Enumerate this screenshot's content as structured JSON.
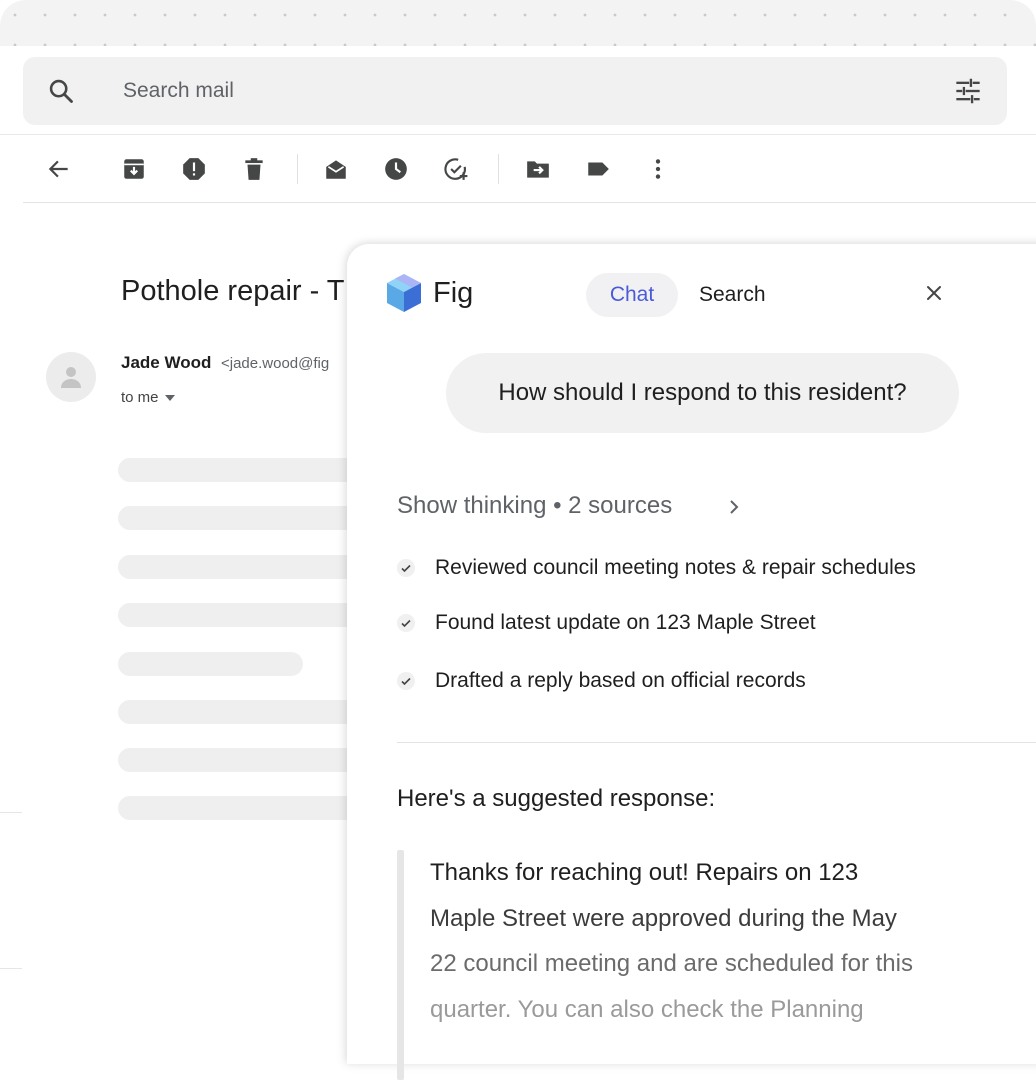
{
  "search": {
    "placeholder": "Search mail"
  },
  "toolbar": {
    "buttons": [
      "back-icon",
      "archive-icon",
      "report-spam-icon",
      "delete-icon",
      "mark-unread-icon",
      "snooze-icon",
      "add-to-tasks-icon",
      "move-to-icon",
      "label-icon",
      "more-vert-icon"
    ]
  },
  "email": {
    "subject": "Pothole repair - T",
    "sender_name": "Jade Wood",
    "sender_email": "<jade.wood@fig",
    "recipient": "to me"
  },
  "fig": {
    "app_name": "Fig",
    "tabs": {
      "chat": "Chat",
      "search": "Search"
    },
    "active_tab": "Chat",
    "user_message": "How should I respond to this resident?",
    "show_thinking": "Show thinking • 2 sources",
    "steps": [
      "Reviewed council meeting notes & repair schedules",
      "Found latest update on 123 Maple Street",
      "Drafted a reply based on official records"
    ],
    "response_heading": "Here's a suggested response:",
    "response_lines": [
      "Thanks for reaching out! Repairs on 123",
      "Maple Street were approved during the May",
      "22 council meeting and are scheduled for this",
      "quarter. You can also check the Planning"
    ]
  },
  "colors": {
    "accent": "#4a5bd8",
    "panel_bg": "#ffffff",
    "bubble_bg": "#f1f1f1",
    "skeleton": "#efefef"
  }
}
